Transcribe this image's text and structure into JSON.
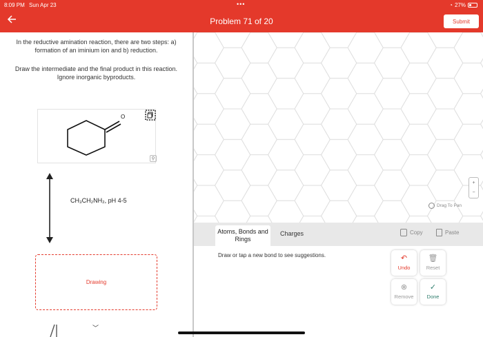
{
  "status": {
    "time": "8:09 PM",
    "date": "Sun Apr 23",
    "battery": "27%"
  },
  "header": {
    "dots": "•••",
    "title": "Problem 71 of 20",
    "submit_label": "Submit"
  },
  "question": {
    "paragraph1": "In the reductive amination reaction, there are two steps: a) formation of an iminium ion and b) reduction.",
    "paragraph2": "Draw the intermediate and the final product in this reaction. Ignore inorganic byproducts.",
    "oxygen_label": "O",
    "reagent": "CH₃CH₂NH₂, pH 4-5",
    "drawing_label": "Drawing"
  },
  "canvas": {
    "drag_to_pan": "Drag To Pan",
    "zoom_in": "+",
    "zoom_out": "−"
  },
  "toolbar": {
    "tab_atoms": "Atoms, Bonds and Rings",
    "tab_charges": "Charges",
    "copy_label": "Copy",
    "paste_label": "Paste"
  },
  "panel": {
    "hint": "Draw or tap a new bond to see suggestions.",
    "undo_label": "Undo",
    "reset_label": "Reset",
    "remove_label": "Remove",
    "done_label": "Done"
  },
  "colors": {
    "brand": "#e4392b",
    "done": "#2f7d6d",
    "toolbar_bg": "#e8e8e8"
  }
}
